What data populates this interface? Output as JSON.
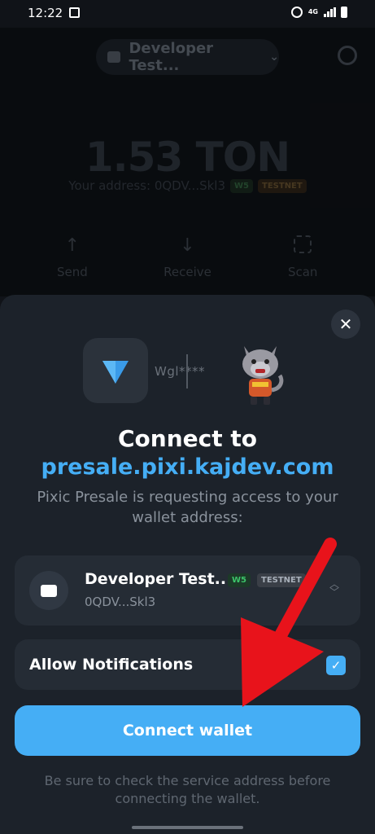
{
  "status_bar": {
    "time": "12:22",
    "network": "4G"
  },
  "background_app": {
    "wallet_selector": "Developer Test...",
    "balance": "1.53 TON",
    "address_label": "Your address: 0QDV...Skl3",
    "tags": {
      "w5": "W5",
      "testnet": "TESTNET"
    },
    "actions": [
      {
        "label": "Send",
        "icon": "arrow-up"
      },
      {
        "label": "Receive",
        "icon": "arrow-down"
      },
      {
        "label": "Scan",
        "icon": "scan"
      }
    ]
  },
  "sheet": {
    "connector_text": "Wgl****",
    "title": "Connect to",
    "domain": "presale.pixi.kajdev.com",
    "description": "Pixic Presale is requesting access to your wallet address:",
    "wallet": {
      "name": "Developer Test...",
      "address": "0QDV...Skl3",
      "tag_w5": "W5",
      "tag_testnet": "TESTNET"
    },
    "notifications": {
      "label": "Allow Notifications",
      "checked": true
    },
    "connect_label": "Connect wallet",
    "footnote": "Be sure to check the service address before connecting the wallet."
  },
  "colors": {
    "accent": "#45aef5",
    "annotation_arrow": "#e8131b"
  }
}
